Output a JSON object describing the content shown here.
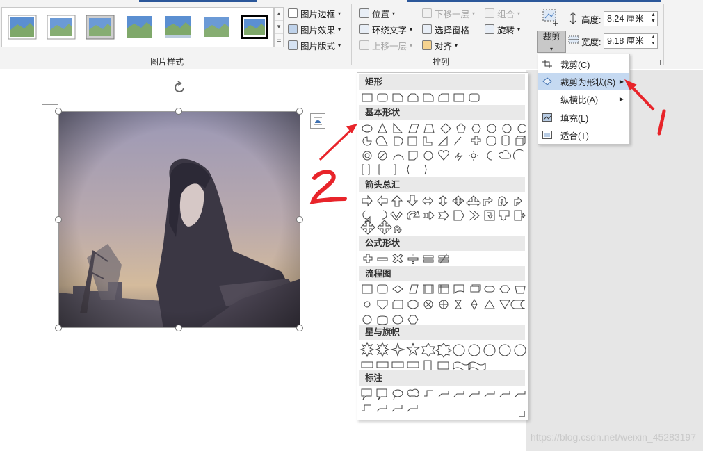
{
  "ribbon": {
    "picture_styles": {
      "label": "图片样式",
      "thumbnail_count": 7,
      "border_button": "图片边框",
      "effects_button": "图片效果",
      "layout_button": "图片版式"
    },
    "arrange": {
      "label": "排列",
      "position": "位置",
      "wrap_text": "环绕文字",
      "bring_forward": "上移一层",
      "send_backward": "下移一层",
      "selection_pane": "选择窗格",
      "align": "对齐",
      "group": "组合",
      "rotate": "旋转"
    },
    "size": {
      "crop_button": "裁剪",
      "height_label": "高度:",
      "height_value": "8.24 厘米",
      "width_label": "宽度:",
      "width_value": "9.18 厘米"
    }
  },
  "crop_menu": {
    "items": [
      {
        "label": "裁剪(C)",
        "selected": false,
        "submenu": false
      },
      {
        "label": "裁剪为形状(S)",
        "selected": true,
        "submenu": true
      },
      {
        "label": "纵横比(A)",
        "selected": false,
        "submenu": true
      },
      {
        "label": "填充(L)",
        "selected": false,
        "submenu": false
      },
      {
        "label": "适合(T)",
        "selected": false,
        "submenu": false
      }
    ]
  },
  "shape_gallery": {
    "sections": [
      {
        "title": "矩形",
        "rows": 1
      },
      {
        "title": "基本形状",
        "rows": 4
      },
      {
        "title": "箭头总汇",
        "rows": 3
      },
      {
        "title": "公式形状",
        "rows": 1
      },
      {
        "title": "流程图",
        "rows": 3
      },
      {
        "title": "星与旗帜",
        "rows": 2
      },
      {
        "title": "标注",
        "rows": 2
      }
    ]
  },
  "annotations": {
    "mark_1": "1",
    "mark_2": "2",
    "color": "#e8242a"
  },
  "watermark": "https://blog.csdn.net/weixin_45283197",
  "colors": {
    "accent": "#2b579a",
    "selected_item": "#c5d9f1",
    "annotation_red": "#e8242a"
  }
}
